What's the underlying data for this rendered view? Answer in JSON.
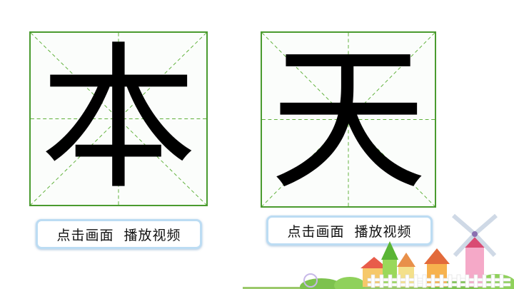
{
  "panels": [
    {
      "character": "本",
      "button_label": "点击画面  播放视频"
    },
    {
      "character": "天",
      "button_label": "点击画面  播放视频"
    }
  ],
  "colors": {
    "grid_border": "#4a9b2f",
    "grid_guides": "#5fb13a",
    "button_border": "#bcdcf3",
    "character": "#000000"
  },
  "decoration": {
    "scene": "cartoon-village-with-windmill-and-fence"
  }
}
